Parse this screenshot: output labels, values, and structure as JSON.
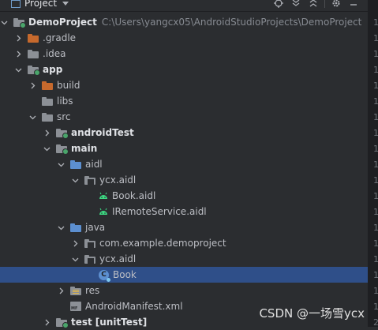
{
  "toolbar": {
    "title": "Project",
    "icons": [
      "window-icon",
      "target-icon",
      "expand-all-icon",
      "collapse-all-icon",
      "settings-icon",
      "minimize-icon"
    ]
  },
  "tree": [
    {
      "indent": 0,
      "arrow": "down",
      "icon": "folder-gray-dot",
      "label": "DemoProject",
      "bold": true,
      "path": "C:\\Users\\yangcx05\\AndroidStudioProjects\\DemoProject"
    },
    {
      "indent": 1,
      "arrow": "right",
      "icon": "folder-orange",
      "label": ".gradle"
    },
    {
      "indent": 1,
      "arrow": "right",
      "icon": "folder-gray",
      "label": ".idea"
    },
    {
      "indent": 1,
      "arrow": "down",
      "icon": "folder-gray-dot",
      "label": "app",
      "bold": true
    },
    {
      "indent": 2,
      "arrow": "right",
      "icon": "folder-orange",
      "label": "build"
    },
    {
      "indent": 2,
      "arrow": "none",
      "icon": "folder-gray",
      "label": "libs"
    },
    {
      "indent": 2,
      "arrow": "down",
      "icon": "folder-gray",
      "label": "src"
    },
    {
      "indent": 3,
      "arrow": "right",
      "icon": "folder-gray-dot",
      "label": "androidTest",
      "bold": true
    },
    {
      "indent": 3,
      "arrow": "down",
      "icon": "folder-gray-dot",
      "label": "main",
      "bold": true
    },
    {
      "indent": 4,
      "arrow": "down",
      "icon": "folder-blue",
      "label": "aidl"
    },
    {
      "indent": 5,
      "arrow": "down",
      "icon": "package",
      "label": "ycx.aidl"
    },
    {
      "indent": 6,
      "arrow": "none",
      "icon": "android",
      "label": "Book.aidl"
    },
    {
      "indent": 6,
      "arrow": "none",
      "icon": "android",
      "label": "IRemoteService.aidl"
    },
    {
      "indent": 4,
      "arrow": "down",
      "icon": "folder-blue",
      "label": "java"
    },
    {
      "indent": 5,
      "arrow": "right",
      "icon": "package",
      "label": "com.example.demoproject"
    },
    {
      "indent": 5,
      "arrow": "down",
      "icon": "package",
      "label": "ycx.aidl"
    },
    {
      "indent": 6,
      "arrow": "none",
      "icon": "class",
      "label": "Book",
      "selected": true
    },
    {
      "indent": 4,
      "arrow": "right",
      "icon": "folder-res",
      "label": "res"
    },
    {
      "indent": 4,
      "arrow": "none",
      "icon": "manifest",
      "label": "AndroidManifest.xml"
    },
    {
      "indent": 3,
      "arrow": "right",
      "icon": "folder-gray-dot",
      "label": "test",
      "bold": true,
      "suffix": "[unitTest]"
    }
  ],
  "gutter": [
    "1",
    "1",
    "1",
    "1",
    "1",
    "1",
    "1",
    "1",
    "1",
    "1",
    "1",
    "1",
    "1",
    "1",
    "1",
    "1",
    "1",
    "1",
    "1",
    "2"
  ],
  "colors": {
    "background": "#2b2d30",
    "selection": "#2f4f89",
    "android": "#3ddc84"
  },
  "watermark": "CSDN @一场雪ycx"
}
